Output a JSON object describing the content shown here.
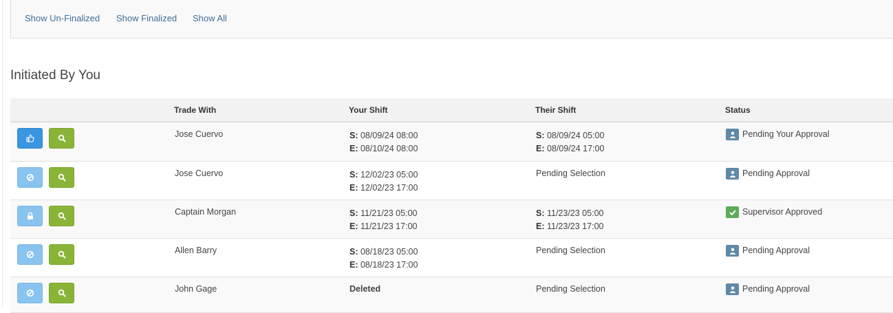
{
  "filters": {
    "un_finalized": "Show Un-Finalized",
    "finalized": "Show Finalized",
    "all": "Show All"
  },
  "section_title": "Initiated By You",
  "table": {
    "headers": {
      "actions": "",
      "trade_with": "Trade With",
      "your_shift": "Your Shift",
      "their_shift": "Their Shift",
      "status": "Status"
    },
    "start_prefix": "S:",
    "end_prefix": "E:",
    "rows": [
      {
        "action_icon": "thumbs-up-icon",
        "trade_with": "Jose Cuervo",
        "your_start": "08/09/24 08:00",
        "your_end": "08/10/24 08:00",
        "their_start": "08/09/24 05:00",
        "their_end": "08/09/24 17:00",
        "their_text": "",
        "status_icon": "user-icon",
        "status": "Pending Your Approval"
      },
      {
        "action_icon": "ban-icon",
        "trade_with": "Jose Cuervo",
        "your_start": "12/02/23 05:00",
        "your_end": "12/02/23 17:00",
        "their_text": "Pending Selection",
        "status_icon": "user-icon",
        "status": "Pending Approval"
      },
      {
        "action_icon": "lock-icon",
        "trade_with": "Captain Morgan",
        "your_start": "11/21/23 05:00",
        "your_end": "11/21/23 17:00",
        "their_start": "11/23/23 05:00",
        "their_end": "11/23/23 17:00",
        "their_text": "",
        "status_icon": "check-icon",
        "status": "Supervisor Approved"
      },
      {
        "action_icon": "ban-icon",
        "trade_with": "Allen Barry",
        "your_start": "08/18/23 05:00",
        "your_end": "08/18/23 17:00",
        "their_text": "Pending Selection",
        "status_icon": "user-icon",
        "status": "Pending Approval"
      },
      {
        "action_icon": "ban-icon",
        "trade_with": "John Gage",
        "your_text": "Deleted",
        "their_text": "Pending Selection",
        "status_icon": "user-icon",
        "status": "Pending Approval"
      }
    ]
  },
  "colors": {
    "link": "#3f6f9a",
    "primary_button": "#3a96e0",
    "disabled_button": "#89c3ef",
    "view_button": "#89b437",
    "pending_badge": "#5e8aa8",
    "approved_badge": "#5cac5c"
  }
}
